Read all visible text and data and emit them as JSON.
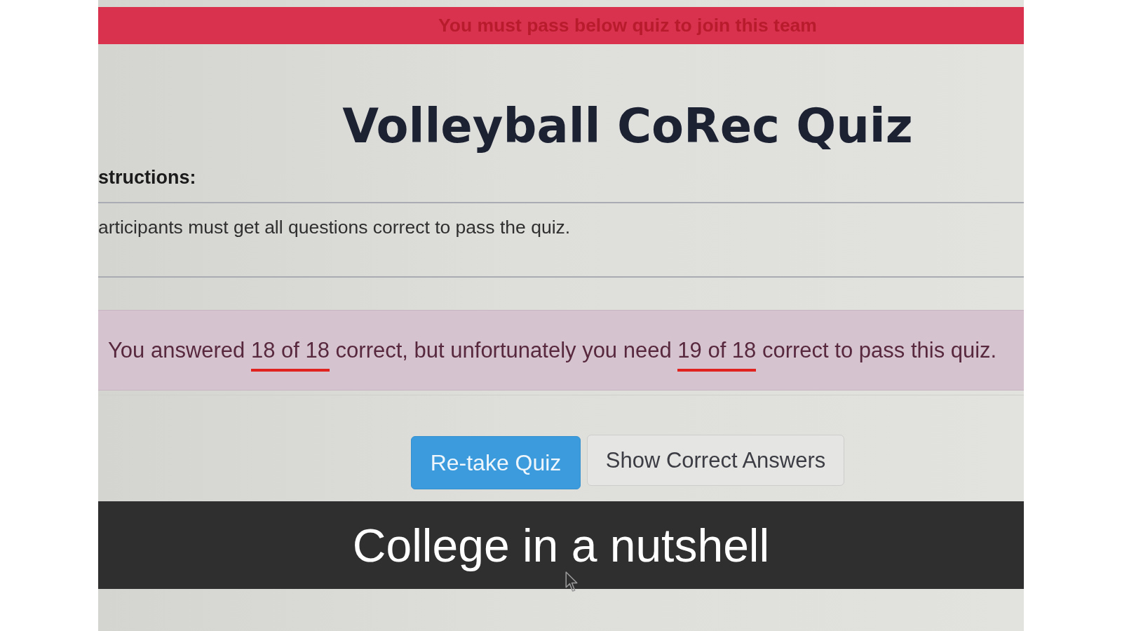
{
  "banner": {
    "text": "You must pass below quiz to join this team"
  },
  "quiz": {
    "title": "Volleyball CoRec Quiz",
    "instructions_label": "structions:",
    "instructions_text": "articipants must get all questions correct to pass the quiz."
  },
  "result_message": {
    "parts": [
      {
        "text": "You answered ",
        "underlined": false
      },
      {
        "text": "18 of 18",
        "underlined": true
      },
      {
        "text": " correct, but unfortunately you need ",
        "underlined": false
      },
      {
        "text": "19 of 18",
        "underlined": true
      },
      {
        "text": " correct to pass this quiz.",
        "underlined": false
      }
    ]
  },
  "buttons": [
    {
      "label": "Re-take Quiz",
      "kind": "primary"
    },
    {
      "label": "Show Correct Answers",
      "kind": "default"
    }
  ],
  "caption": {
    "text": "College in a nutshell"
  }
}
